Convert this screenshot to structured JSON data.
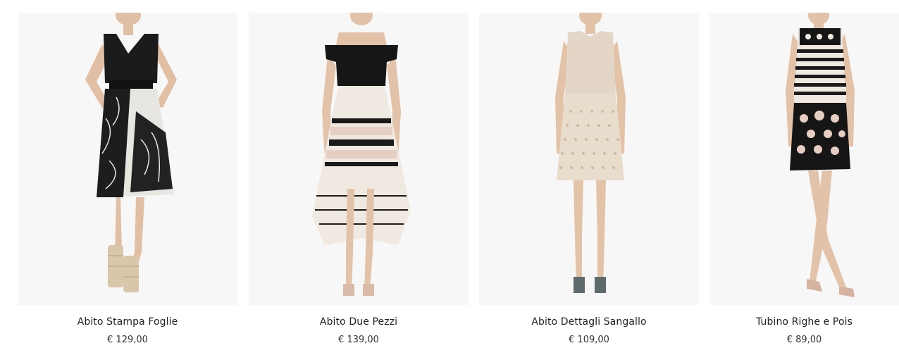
{
  "products": [
    {
      "name": "Abito Stampa Foglie",
      "price": "€ 129,00",
      "image_icon": "dress-leaf-print-image"
    },
    {
      "name": "Abito Due Pezzi",
      "price": "€ 139,00",
      "image_icon": "dress-two-piece-image"
    },
    {
      "name": "Abito Dettagli Sangallo",
      "price": "€ 109,00",
      "image_icon": "dress-sangallo-image"
    },
    {
      "name": "Tubino Righe e Pois",
      "price": "€ 89,00",
      "image_icon": "dress-stripes-dots-image"
    }
  ],
  "colors": {
    "photo_background": "#f5f5f5",
    "skin": "#e2c2a8",
    "black": "#1a1a1a",
    "cream": "#e9dccd",
    "blush": "#e6cfc2"
  }
}
